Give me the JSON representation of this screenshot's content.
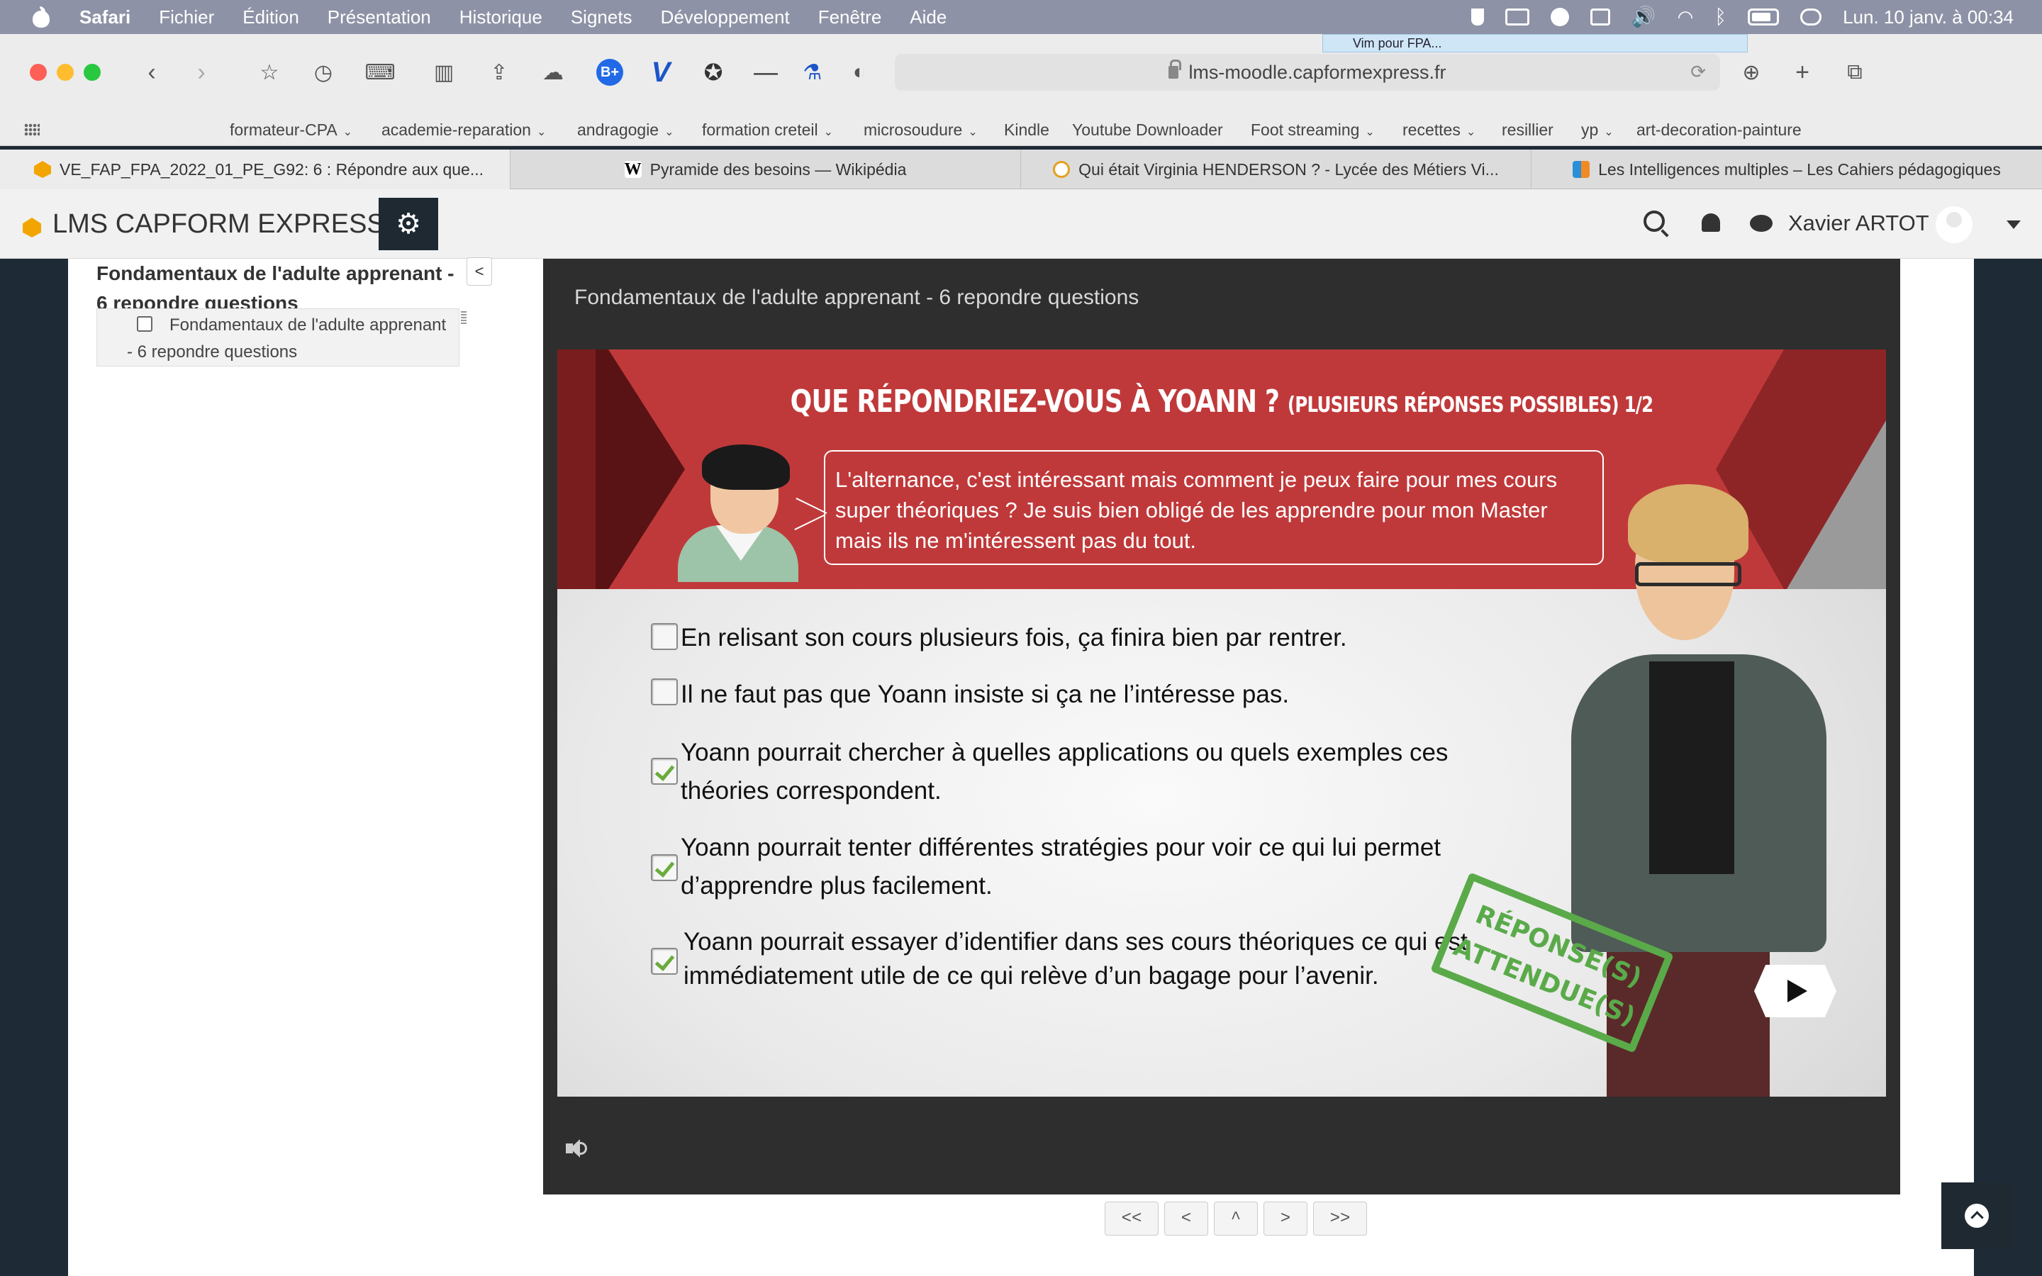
{
  "menubar": {
    "app": "Safari",
    "items": [
      "Fichier",
      "Édition",
      "Présentation",
      "Historique",
      "Signets",
      "Développement",
      "Fenêtre",
      "Aide"
    ],
    "clock": "Lun. 10 janv. à  00:34"
  },
  "vim_tip": "Vim pour FPA...",
  "address": {
    "url": "lms-moodle.capformexpress.fr"
  },
  "favorites": [
    {
      "label": "formateur-CPA",
      "dropdown": true
    },
    {
      "label": "academie-reparation",
      "dropdown": true
    },
    {
      "label": "andragogie",
      "dropdown": true
    },
    {
      "label": "formation creteil",
      "dropdown": true
    },
    {
      "label": "microsoudure",
      "dropdown": true
    },
    {
      "label": "Kindle",
      "dropdown": false
    },
    {
      "label": "Youtube Downloader",
      "dropdown": false
    },
    {
      "label": "Foot streaming",
      "dropdown": true
    },
    {
      "label": "recettes",
      "dropdown": true
    },
    {
      "label": "resillier",
      "dropdown": false
    },
    {
      "label": "yp",
      "dropdown": true
    },
    {
      "label": "art-decoration-painture",
      "dropdown": false
    }
  ],
  "tabs": [
    {
      "title": "VE_FAP_FPA_2022_01_PE_G92: 6 : Répondre aux que...",
      "active": true,
      "icon": "moodle-favicon"
    },
    {
      "title": "Pyramide des besoins — Wikipédia",
      "active": false,
      "icon": "wikipedia-favicon"
    },
    {
      "title": "Qui était Virginia HENDERSON ? - Lycée des Métiers Vi...",
      "active": false,
      "icon": "lycee-favicon"
    },
    {
      "title": "Les Intelligences multiples – Les Cahiers pédagogiques",
      "active": false,
      "icon": "cahiers-favicon"
    }
  ],
  "header": {
    "site_name": "LMS CAPFORM EXPRESS",
    "user_name": "Xavier ARTOT"
  },
  "sidebar": {
    "title": "Fondamentaux de l'adulte apprenant - 6 repondre questions",
    "collapse_label": "<",
    "toc_item": "Fondamentaux de l'adulte apprenant - 6 repondre questions"
  },
  "player": {
    "title": "Fondamentaux de l'adulte apprenant - 6 repondre questions"
  },
  "slide": {
    "question_title": "QUE RÉPONDRIEZ-VOUS À YOANN ?",
    "question_subtitle": "(PLUSIEURS RÉPONSES POSSIBLES) 1/2",
    "speech": "L'alternance, c'est intéressant mais comment je peux faire pour mes cours super théoriques ? Je suis bien obligé de les apprendre pour mon Master mais ils ne m'intéressent pas du tout.",
    "answers": [
      {
        "text": "En relisant son cours plusieurs fois, ça finira bien par rentrer.",
        "checked": false
      },
      {
        "text": "Il ne faut pas que Yoann insiste si ça ne l’intéresse pas.",
        "checked": false
      },
      {
        "text": "Yoann pourrait chercher à quelles applications ou quels exemples ces théories correspondent.",
        "checked": true
      },
      {
        "text": " Yoann pourrait tenter différentes stratégies pour voir ce qui lui permet d’apprendre plus facilement.",
        "checked": true
      },
      {
        "text": "Yoann pourrait essayer d’identifier dans ses cours théoriques ce qui est immédiatement utile de ce qui relève d’un bagage pour l’avenir.",
        "checked": true
      }
    ],
    "stamp": "RÉPONSE(S) ATTENDUE(S)",
    "stamp_color": "#5aaa4a",
    "banner_color": "#c0393a"
  },
  "nav_buttons": [
    "<<",
    "<",
    "^",
    ">",
    ">>"
  ]
}
